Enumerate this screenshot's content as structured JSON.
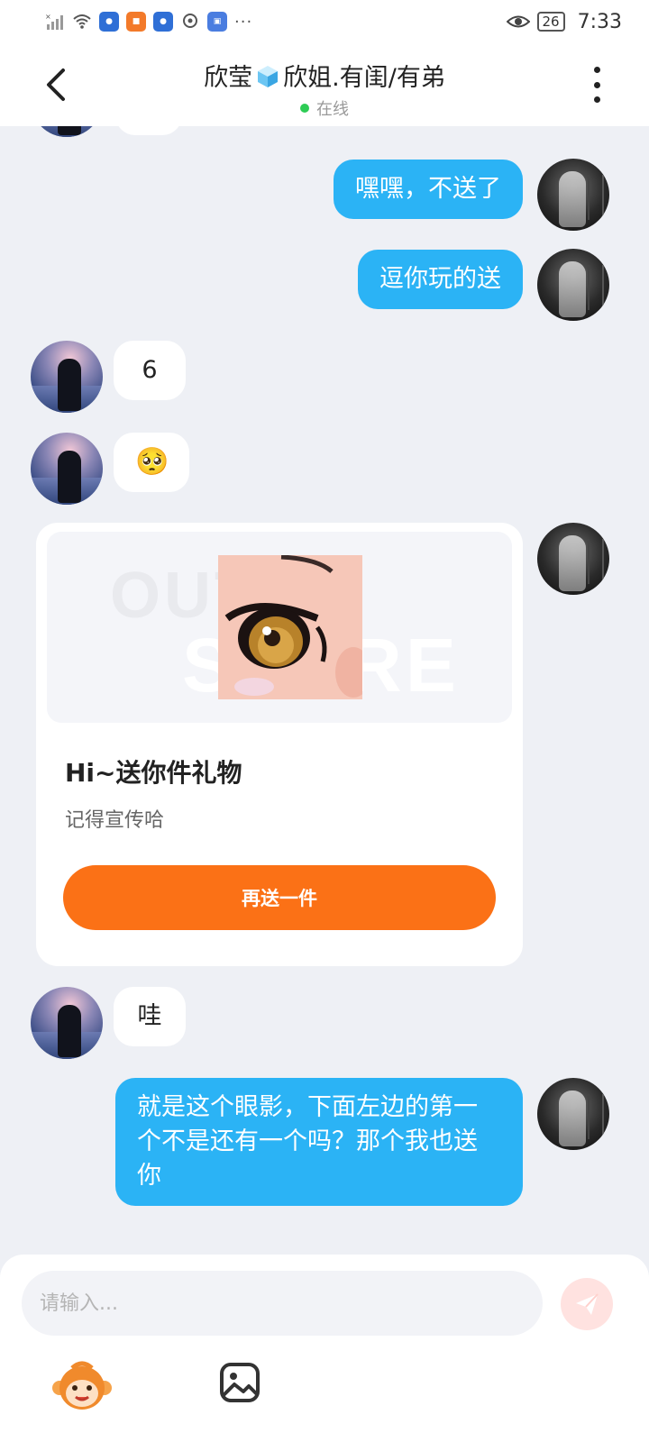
{
  "status_bar": {
    "battery": "26",
    "time": "7:33",
    "more": "···"
  },
  "header": {
    "title_part1": "欣莹",
    "title_part2": "欣姐.有闺/有弟",
    "status": "在线"
  },
  "messages": [
    {
      "side": "me",
      "text": "嘿嘿，不送了"
    },
    {
      "side": "me",
      "text": "逗你玩的送"
    },
    {
      "side": "her",
      "text": "6"
    },
    {
      "side": "her",
      "text": "🥺"
    },
    {
      "side": "her",
      "text": "哇"
    },
    {
      "side": "me",
      "text": "就是这个眼影，下面左边的第一个不是还有一个吗？那个我也送你"
    }
  ],
  "gift_card": {
    "watermark_line1": "OUTER",
    "watermark_line2": "STORE",
    "title": "Hi~送你件礼物",
    "subtitle": "记得宣传哈",
    "button_label": "再送一件"
  },
  "composer": {
    "placeholder": "请输入...",
    "value": ""
  },
  "colors": {
    "my_bubble": "#2bb3f5",
    "gift_button": "#fb7116",
    "online_dot": "#2ecc55",
    "background": "#eef0f5"
  },
  "icons": {
    "back": "chevron-left-icon",
    "more": "more-vertical-icon",
    "send": "paper-plane-icon",
    "emoji": "monkey-emoji-icon",
    "image": "image-icon"
  }
}
